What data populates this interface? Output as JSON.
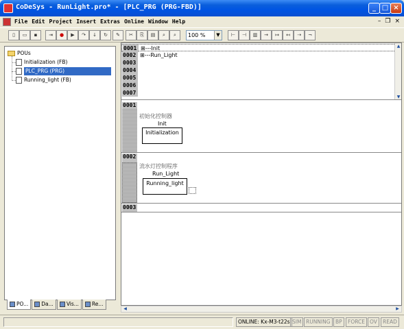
{
  "window": {
    "title": "CoDeSys - RunLight.pro* - [PLC_PRG (PRG-FBD)]"
  },
  "menu": {
    "items": [
      "File",
      "Edit",
      "Project",
      "Insert",
      "Extras",
      "Online",
      "Window",
      "Help"
    ]
  },
  "toolbar": {
    "zoom": "100 %"
  },
  "tree": {
    "root": "POUs",
    "items": [
      {
        "label": "Initialization (FB)",
        "selected": false
      },
      {
        "label": "PLC_PRG (PRG)",
        "selected": true
      },
      {
        "label": "Running_light (FB)",
        "selected": false
      }
    ]
  },
  "tabs": [
    {
      "label": "PO..."
    },
    {
      "label": "Da..."
    },
    {
      "label": "Vis..."
    },
    {
      "label": "Re..."
    }
  ],
  "declarations": [
    {
      "num": "0001",
      "text": "⊞---Init"
    },
    {
      "num": "0002",
      "text": "⊞---Run_Light"
    },
    {
      "num": "0003",
      "text": ""
    },
    {
      "num": "0004",
      "text": ""
    },
    {
      "num": "0005",
      "text": ""
    },
    {
      "num": "0006",
      "text": ""
    },
    {
      "num": "0007",
      "text": ""
    }
  ],
  "networks": [
    {
      "num": "0001",
      "comment": "初始化控制器",
      "instance": "Init",
      "block": "Initialization"
    },
    {
      "num": "0002",
      "comment": "流水灯控制程序",
      "instance": "Run_Light",
      "block": "Running_light"
    },
    {
      "num": "0003",
      "comment": "",
      "instance": "",
      "block": ""
    }
  ],
  "status": {
    "online": "ONLINE: Kx-M3-t22s",
    "sim": "SIM",
    "running": "RUNNING",
    "bp": "BP",
    "force": "FORCE",
    "ov": "OV",
    "read": "READ"
  }
}
